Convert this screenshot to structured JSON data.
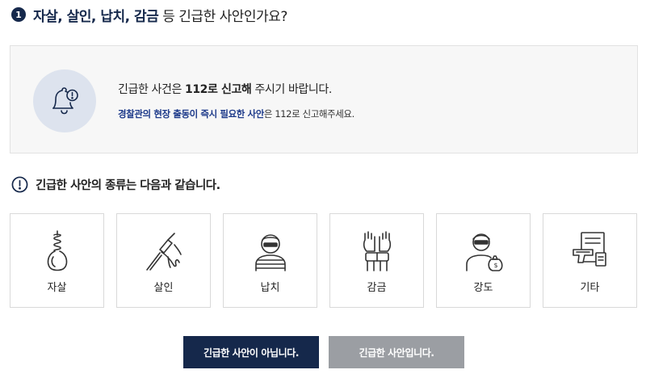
{
  "question": {
    "number": "1",
    "title": "자살, 살인, 납치, 감금",
    "title_suffix": "등 긴급한 사안인가요?"
  },
  "notice": {
    "line1_pre": "긴급한 사건은 ",
    "line1_bold": "112로 신고해",
    "line1_post": " 주시기 바랍니다.",
    "line2_highlight": "경찰관의 현장 출동이 즉시 필요한 사안",
    "line2_rest": "은 112로 신고해주세요.",
    "icon": "bell-alert-icon"
  },
  "types": {
    "title": "긴급한 사안의 종류는 다음과 같습니다.",
    "items": [
      {
        "label": "자살",
        "icon": "noose-icon"
      },
      {
        "label": "살인",
        "icon": "stabbing-icon"
      },
      {
        "label": "납치",
        "icon": "hostage-icon"
      },
      {
        "label": "감금",
        "icon": "bound-hands-icon"
      },
      {
        "label": "강도",
        "icon": "robber-icon"
      },
      {
        "label": "기타",
        "icon": "document-gun-icon"
      }
    ]
  },
  "buttons": {
    "not_urgent": "긴급한 사안이 아닙니다.",
    "urgent": "긴급한 사안입니다."
  },
  "colors": {
    "navy": "#15284b",
    "gray_button": "#9b9ea3",
    "bell_bg": "#dde3ee",
    "highlight_blue": "#1d3a8a"
  }
}
